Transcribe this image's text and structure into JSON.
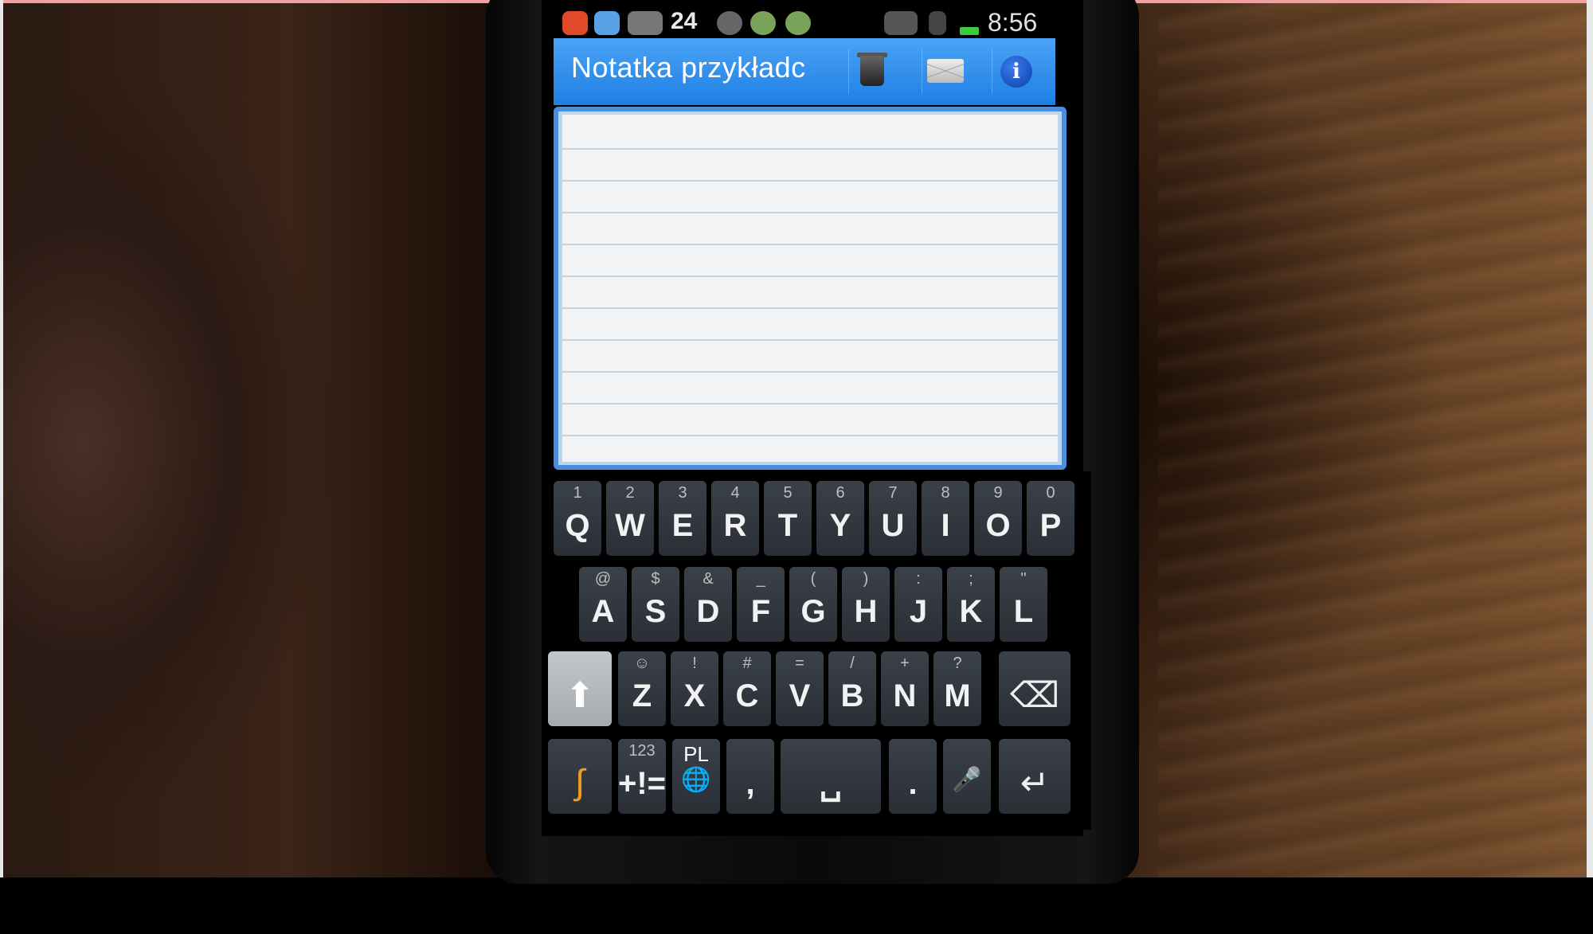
{
  "status_bar": {
    "number": "24",
    "time": "8:56",
    "icons": [
      "app-icon",
      "mail-icon",
      "keyboard-icon",
      "recycle-icon",
      "shield-icon",
      "shield-icon",
      "vibrate-icon",
      "signal-icon",
      "battery-icon"
    ]
  },
  "app_header": {
    "title": "Notatka przykładc",
    "buttons": [
      "trash-icon",
      "mail-icon",
      "info-icon"
    ],
    "info_glyph": "i",
    "accent": "#2a8ae8"
  },
  "keyboard": {
    "row1": [
      {
        "alt": "1",
        "main": "Q"
      },
      {
        "alt": "2",
        "main": "W"
      },
      {
        "alt": "3",
        "main": "E"
      },
      {
        "alt": "4",
        "main": "R"
      },
      {
        "alt": "5",
        "main": "T"
      },
      {
        "alt": "6",
        "main": "Y"
      },
      {
        "alt": "7",
        "main": "U"
      },
      {
        "alt": "8",
        "main": "I"
      },
      {
        "alt": "9",
        "main": "O"
      },
      {
        "alt": "0",
        "main": "P"
      }
    ],
    "row2": [
      {
        "alt": "@",
        "main": "A"
      },
      {
        "alt": "$",
        "main": "S"
      },
      {
        "alt": "&",
        "main": "D"
      },
      {
        "alt": "_",
        "main": "F"
      },
      {
        "alt": "(",
        "main": "G"
      },
      {
        "alt": ")",
        "main": "H"
      },
      {
        "alt": ":",
        "main": "J"
      },
      {
        "alt": ";",
        "main": "K"
      },
      {
        "alt": "\"",
        "main": "L"
      }
    ],
    "row3": [
      {
        "alt": "☺",
        "main": "Z"
      },
      {
        "alt": "!",
        "main": "X"
      },
      {
        "alt": "#",
        "main": "C"
      },
      {
        "alt": "=",
        "main": "V"
      },
      {
        "alt": "/",
        "main": "B"
      },
      {
        "alt": "+",
        "main": "N"
      },
      {
        "alt": "?",
        "main": "M"
      }
    ],
    "row4": {
      "symbols_top": "123",
      "symbols_main": "+!=",
      "lang_top": "PL",
      "comma": ",",
      "period": "."
    },
    "shift_glyph": "⬆",
    "backspace_glyph": "⌫",
    "enter_glyph": "↵",
    "globe_glyph": "🌐",
    "space_glyph": "␣",
    "mic_glyph": "🎤",
    "swype_glyph": "∫"
  }
}
